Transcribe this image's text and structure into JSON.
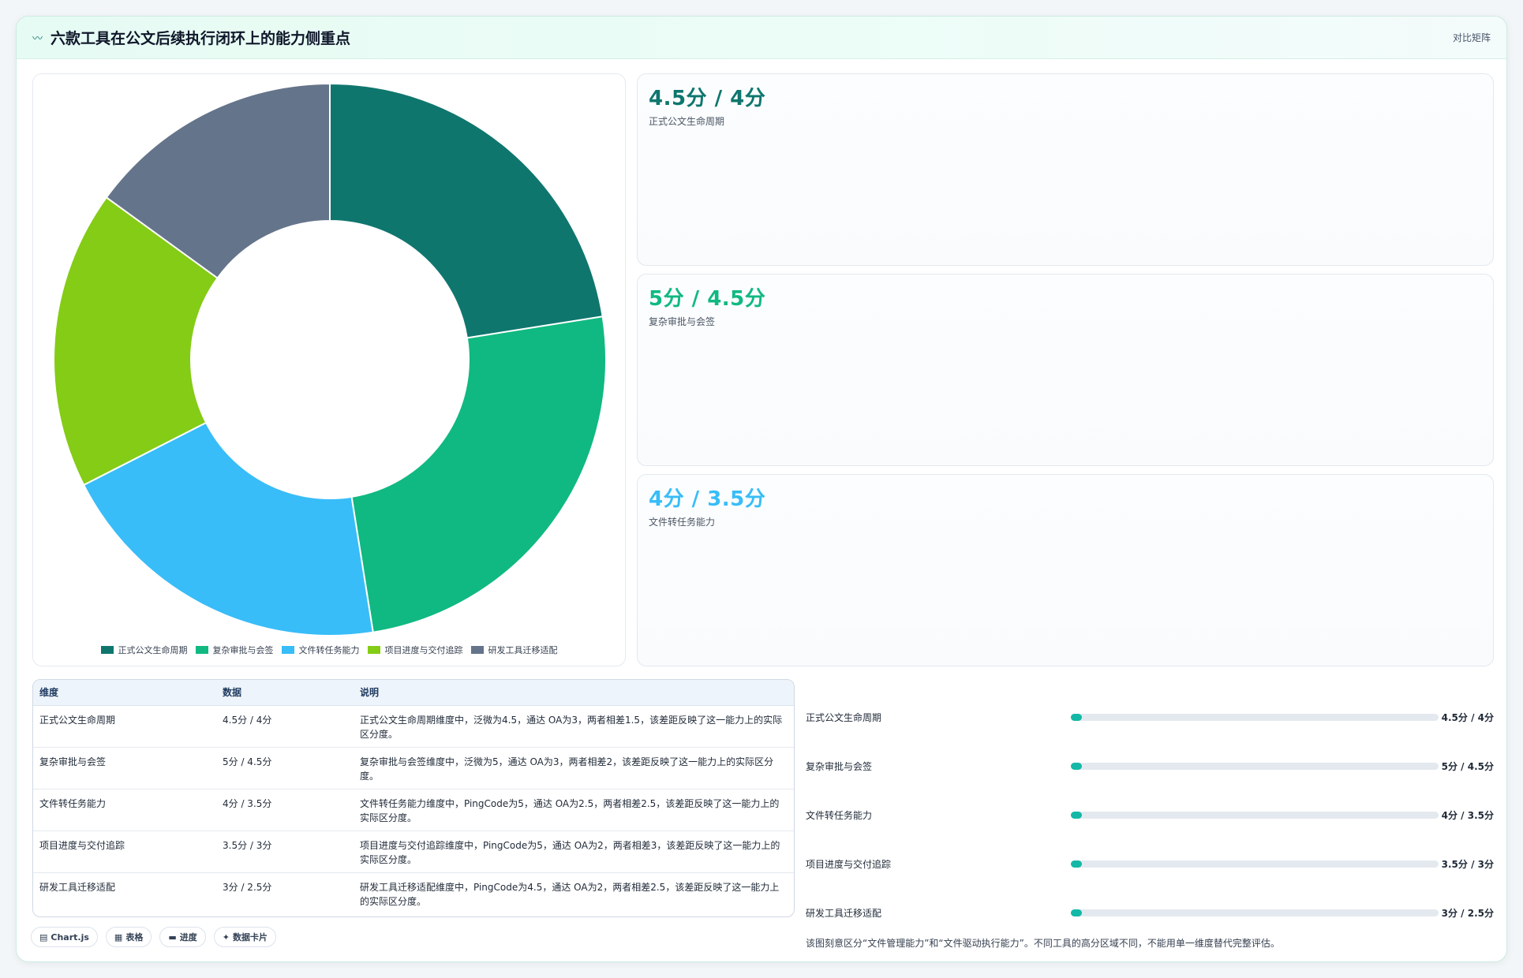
{
  "header": {
    "title": "六款工具在公文后续执行闭环上的能力侧重点",
    "tag": "对比矩阵",
    "icon": "wave-icon"
  },
  "chart_data": {
    "type": "pie",
    "donut": true,
    "categories": [
      "正式公文生命周期",
      "复杂审批与会签",
      "文件转任务能力",
      "项目进度与交付追踪",
      "研发工具迁移适配"
    ],
    "values": [
      4.5,
      5,
      4,
      3.5,
      3
    ],
    "colors": [
      "#0f766e",
      "#10b981",
      "#38bdf8",
      "#84cc16",
      "#64748b"
    ],
    "legend": "bottom"
  },
  "stats": [
    {
      "value": "4.5分 / 4分",
      "label": "正式公文生命周期",
      "color": "#0f766e"
    },
    {
      "value": "5分 / 4.5分",
      "label": "复杂审批与会签",
      "color": "#10b981"
    },
    {
      "value": "4分 / 3.5分",
      "label": "文件转任务能力",
      "color": "#38bdf8"
    }
  ],
  "table": {
    "headers": [
      "维度",
      "数据",
      "说明"
    ],
    "rows": [
      {
        "dim": "正式公文生命周期",
        "data": "4.5分 / 4分",
        "desc": "正式公文生命周期维度中，泛微为4.5，通达 OA为3，两者相差1.5，该差距反映了这一能力上的实际区分度。"
      },
      {
        "dim": "复杂审批与会签",
        "data": "5分 / 4.5分",
        "desc": "复杂审批与会签维度中，泛微为5，通达 OA为3，两者相差2，该差距反映了这一能力上的实际区分度。"
      },
      {
        "dim": "文件转任务能力",
        "data": "4分 / 3.5分",
        "desc": "文件转任务能力维度中，PingCode为5，通达 OA为2.5，两者相差2.5，该差距反映了这一能力上的实际区分度。"
      },
      {
        "dim": "项目进度与交付追踪",
        "data": "3.5分 / 3分",
        "desc": "项目进度与交付追踪维度中，PingCode为5，通达 OA为2，两者相差3，该差距反映了这一能力上的实际区分度。"
      },
      {
        "dim": "研发工具迁移适配",
        "data": "3分 / 2.5分",
        "desc": "研发工具迁移适配维度中，PingCode为4.5，通达 OA为2，两者相差2.5，该差距反映了这一能力上的实际区分度。"
      }
    ]
  },
  "progress": [
    {
      "label": "正式公文生命周期",
      "value": "4.5分 / 4分",
      "fraction": 0.03
    },
    {
      "label": "复杂审批与会签",
      "value": "5分 / 4.5分",
      "fraction": 0.03
    },
    {
      "label": "文件转任务能力",
      "value": "4分 / 3.5分",
      "fraction": 0.03
    },
    {
      "label": "项目进度与交付追踪",
      "value": "3.5分 / 3分",
      "fraction": 0.03
    },
    {
      "label": "研发工具迁移适配",
      "value": "3分 / 2.5分",
      "fraction": 0.03
    }
  ],
  "note": "该图刻意区分“文件管理能力”和“文件驱动执行能力”。不同工具的高分区域不同，不能用单一维度替代完整评估。",
  "chips": [
    {
      "icon": "▤",
      "icon_name": "chart-icon",
      "label": "Chart.js"
    },
    {
      "icon": "▦",
      "icon_name": "table-icon",
      "label": "表格"
    },
    {
      "icon": "▬",
      "icon_name": "progress-icon",
      "label": "进度"
    },
    {
      "icon": "✦",
      "icon_name": "card-icon",
      "label": "数据卡片"
    }
  ]
}
